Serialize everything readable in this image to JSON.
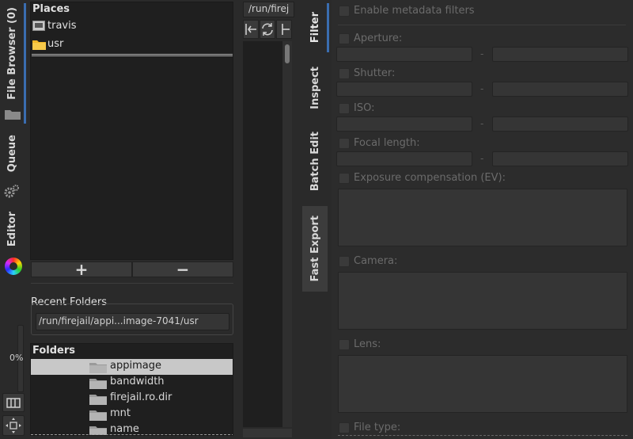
{
  "left_tabs": {
    "file_browser": "File Browser (0)",
    "queue": "Queue",
    "editor": "Editor",
    "zoom": "0%"
  },
  "places": {
    "header": "Places",
    "items": [
      {
        "label": "travis",
        "icon": "drive-icon"
      },
      {
        "label": "usr",
        "icon": "folder-icon"
      }
    ],
    "add_label": "+",
    "remove_label": "−"
  },
  "recent": {
    "header": "Recent Folders",
    "value": "/run/firejail/appi...image-7041/usr"
  },
  "folders": {
    "header": "Folders",
    "items": [
      "appimage",
      "bandwidth",
      "firejail.ro.dir",
      "mnt",
      "name"
    ]
  },
  "path_field": "/run/firej",
  "right_tabs": {
    "filter": "Filter",
    "inspect": "Inspect",
    "batch_edit": "Batch Edit",
    "fast_export": "Fast Export"
  },
  "filter": {
    "enable": "Enable metadata filters",
    "aperture": "Aperture:",
    "shutter": "Shutter:",
    "iso": "ISO:",
    "focal_length": "Focal length:",
    "exposure": "Exposure compensation (EV):",
    "camera": "Camera:",
    "lens": "Lens:",
    "file_type": "File type:",
    "dash": "-"
  },
  "colors": {
    "accent": "#3a6db0",
    "panel": "#2a2a2a",
    "dark": "#1f1f1f"
  }
}
